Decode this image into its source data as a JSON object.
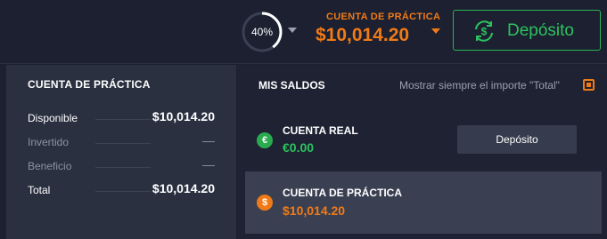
{
  "header": {
    "progress_text": "40%",
    "progress_value": 0.4,
    "account_label": "CUENTA DE PRÁCTICA",
    "account_balance": "$10,014.20",
    "deposit_label": "Depósito"
  },
  "left_panel": {
    "title": "CUENTA DE PRÁCTICA",
    "rows": [
      {
        "name": "Disponible",
        "value": "$10,014.20"
      },
      {
        "name": "Invertido",
        "value": "—"
      },
      {
        "name": "Beneficio",
        "value": "—"
      },
      {
        "name": "Total",
        "value": "$10,014.20"
      }
    ]
  },
  "right_panel": {
    "title": "MIS SALDOS",
    "show_total_label": "Mostrar siempre el importe \"Total\"",
    "accounts": [
      {
        "name": "CUENTA REAL",
        "amount": "€0.00",
        "currency_symbol": "€",
        "deposit_label": "Depósito"
      },
      {
        "name": "CUENTA DE PRÁCTICA",
        "amount": "$10,014.20",
        "currency_symbol": "$"
      }
    ]
  },
  "colors": {
    "accent_orange": "#f07a17",
    "accent_green": "#2cc25f",
    "background": "#1c2030",
    "panel": "#2a3040"
  }
}
